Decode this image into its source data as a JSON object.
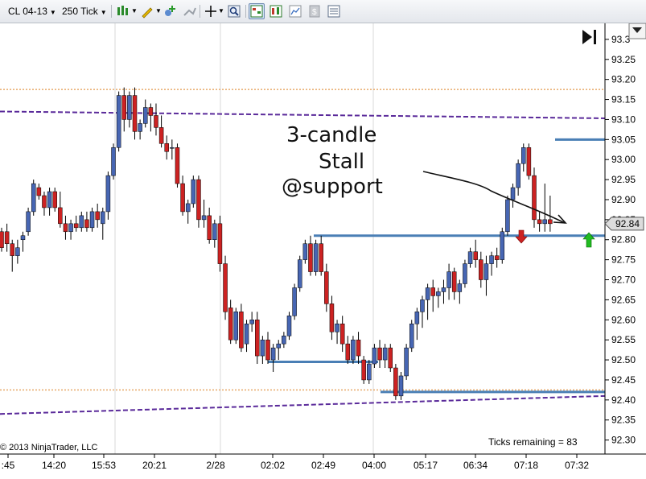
{
  "toolbar": {
    "instrument": "CL 04-13",
    "period": "250 Tick"
  },
  "footer": {
    "copyright": "© 2013 NinjaTrader, LLC",
    "ticks_remaining": "Ticks remaining = 83"
  },
  "annotation": {
    "line1": "3-candle",
    "line2": "Stall",
    "line3": "@support"
  },
  "colors": {
    "up": "#4766b3",
    "down": "#cc2222",
    "hline": "#4a7fb5",
    "channel": "#5a2a9a",
    "dotted": "#e8a96a",
    "arrow_down": "#cc2222",
    "arrow_up": "#22bb22"
  },
  "chart_data": {
    "type": "candlestick",
    "ylim": [
      92.265,
      93.34
    ],
    "y_ticks": [
      "93.3",
      "93.25",
      "93.20",
      "93.15",
      "93.10",
      "93.05",
      "93.00",
      "92.95",
      "92.90",
      "92.85",
      "92.80",
      "92.75",
      "92.70",
      "92.65",
      "92.60",
      "92.55",
      "92.50",
      "92.45",
      "92.40",
      "92.35",
      "92.30"
    ],
    "x_ticks": [
      ":45",
      "14:20",
      "15:53",
      "20:21",
      "2/28",
      "02:02",
      "02:49",
      "04:00",
      "05:17",
      "06:34",
      "07:18",
      "07:32"
    ],
    "last_price": "92.84",
    "candles": [
      [
        92.82,
        92.83,
        92.77,
        92.78
      ],
      [
        92.82,
        92.84,
        92.77,
        92.79
      ],
      [
        92.79,
        92.8,
        92.72,
        92.76
      ],
      [
        92.76,
        92.8,
        92.74,
        92.78
      ],
      [
        92.8,
        92.82,
        92.77,
        92.81
      ],
      [
        92.82,
        92.88,
        92.81,
        92.87
      ],
      [
        92.87,
        92.95,
        92.86,
        92.94
      ],
      [
        92.93,
        92.94,
        92.9,
        92.91
      ],
      [
        92.91,
        92.92,
        92.86,
        92.88
      ],
      [
        92.88,
        92.93,
        92.86,
        92.92
      ],
      [
        92.92,
        92.93,
        92.87,
        92.88
      ],
      [
        92.88,
        92.92,
        92.83,
        92.84
      ],
      [
        92.84,
        92.86,
        92.8,
        92.82
      ],
      [
        92.82,
        92.85,
        92.8,
        92.84
      ],
      [
        92.84,
        92.86,
        92.82,
        92.83
      ],
      [
        92.83,
        92.87,
        92.82,
        92.86
      ],
      [
        92.85,
        92.87,
        92.82,
        92.83
      ],
      [
        92.83,
        92.88,
        92.82,
        92.87
      ],
      [
        92.87,
        92.89,
        92.83,
        92.85
      ],
      [
        92.84,
        92.88,
        92.8,
        92.87
      ],
      [
        92.87,
        92.97,
        92.85,
        92.96
      ],
      [
        92.96,
        93.04,
        92.95,
        93.03
      ],
      [
        93.03,
        93.17,
        93.02,
        93.16
      ],
      [
        93.16,
        93.18,
        93.07,
        93.1
      ],
      [
        93.1,
        93.17,
        93.08,
        93.16
      ],
      [
        93.16,
        93.18,
        93.05,
        93.07
      ],
      [
        93.07,
        93.1,
        93.05,
        93.09
      ],
      [
        93.09,
        93.15,
        93.08,
        93.13
      ],
      [
        93.13,
        93.14,
        93.07,
        93.11
      ],
      [
        93.11,
        93.14,
        93.06,
        93.08
      ],
      [
        93.08,
        93.11,
        93.03,
        93.04
      ],
      [
        93.04,
        93.06,
        93.0,
        93.02
      ],
      [
        93.03,
        93.05,
        93.0,
        93.03
      ],
      [
        93.03,
        93.04,
        92.93,
        92.94
      ],
      [
        92.94,
        92.96,
        92.86,
        92.87
      ],
      [
        92.87,
        92.9,
        92.84,
        92.89
      ],
      [
        92.89,
        92.96,
        92.88,
        92.95
      ],
      [
        92.95,
        92.96,
        92.83,
        92.85
      ],
      [
        92.85,
        92.9,
        92.83,
        92.86
      ],
      [
        92.86,
        92.88,
        92.79,
        92.8
      ],
      [
        92.8,
        92.85,
        92.78,
        92.84
      ],
      [
        92.84,
        92.86,
        92.72,
        92.74
      ],
      [
        92.74,
        92.76,
        92.6,
        92.62
      ],
      [
        92.63,
        92.65,
        92.54,
        92.55
      ],
      [
        92.55,
        92.63,
        92.54,
        92.62
      ],
      [
        92.62,
        92.64,
        92.52,
        92.53
      ],
      [
        92.54,
        92.6,
        92.52,
        92.59
      ],
      [
        92.59,
        92.62,
        92.57,
        92.6
      ],
      [
        92.6,
        92.62,
        92.49,
        92.51
      ],
      [
        92.51,
        92.56,
        92.49,
        92.55
      ],
      [
        92.55,
        92.57,
        92.49,
        92.5
      ],
      [
        92.5,
        92.54,
        92.47,
        92.53
      ],
      [
        92.53,
        92.55,
        92.5,
        92.54
      ],
      [
        92.54,
        92.57,
        92.53,
        92.56
      ],
      [
        92.56,
        92.62,
        92.55,
        92.61
      ],
      [
        92.61,
        92.69,
        92.6,
        92.68
      ],
      [
        92.68,
        92.76,
        92.67,
        92.75
      ],
      [
        92.75,
        92.8,
        92.74,
        92.79
      ],
      [
        92.79,
        92.81,
        92.71,
        92.72
      ],
      [
        92.72,
        92.8,
        92.71,
        92.79
      ],
      [
        92.79,
        92.81,
        92.71,
        92.72
      ],
      [
        92.72,
        92.74,
        92.62,
        92.64
      ],
      [
        92.64,
        92.66,
        92.55,
        92.57
      ],
      [
        92.57,
        92.6,
        92.54,
        92.59
      ],
      [
        92.59,
        92.61,
        92.52,
        92.54
      ],
      [
        92.54,
        92.56,
        92.49,
        92.5
      ],
      [
        92.5,
        92.56,
        92.49,
        92.55
      ],
      [
        92.55,
        92.57,
        92.49,
        92.51
      ],
      [
        92.5,
        92.51,
        92.44,
        92.45
      ],
      [
        92.45,
        92.5,
        92.44,
        92.49
      ],
      [
        92.49,
        92.54,
        92.48,
        92.53
      ],
      [
        92.53,
        92.55,
        92.48,
        92.5
      ],
      [
        92.5,
        92.54,
        92.48,
        92.53
      ],
      [
        92.53,
        92.54,
        92.47,
        92.48
      ],
      [
        92.48,
        92.49,
        92.4,
        92.41
      ],
      [
        92.41,
        92.47,
        92.4,
        92.46
      ],
      [
        92.46,
        92.54,
        92.45,
        92.53
      ],
      [
        92.53,
        92.6,
        92.52,
        92.59
      ],
      [
        92.59,
        92.63,
        92.55,
        92.62
      ],
      [
        92.62,
        92.66,
        92.58,
        92.65
      ],
      [
        92.65,
        92.69,
        92.6,
        92.68
      ],
      [
        92.68,
        92.7,
        92.62,
        92.66
      ],
      [
        92.66,
        92.68,
        92.63,
        92.67
      ],
      [
        92.67,
        92.7,
        92.64,
        92.68
      ],
      [
        92.68,
        92.74,
        92.65,
        92.72
      ],
      [
        92.72,
        92.73,
        92.65,
        92.67
      ],
      [
        92.67,
        92.7,
        92.64,
        92.69
      ],
      [
        92.69,
        92.75,
        92.68,
        92.74
      ],
      [
        92.74,
        92.78,
        92.73,
        92.77
      ],
      [
        92.77,
        92.8,
        92.73,
        92.75
      ],
      [
        92.75,
        92.77,
        92.68,
        92.7
      ],
      [
        92.7,
        92.76,
        92.66,
        92.74
      ],
      [
        92.74,
        92.77,
        92.71,
        92.76
      ],
      [
        92.76,
        92.78,
        92.73,
        92.75
      ],
      [
        92.75,
        92.83,
        92.74,
        92.82
      ],
      [
        92.82,
        92.91,
        92.81,
        92.9
      ],
      [
        92.9,
        92.94,
        92.88,
        92.93
      ],
      [
        92.93,
        93.0,
        92.91,
        92.99
      ],
      [
        92.99,
        93.04,
        92.97,
        93.03
      ],
      [
        93.03,
        93.04,
        92.95,
        92.96
      ],
      [
        92.96,
        92.98,
        92.83,
        92.85
      ],
      [
        92.85,
        92.87,
        92.82,
        92.84
      ],
      [
        92.84,
        92.94,
        92.82,
        92.85
      ],
      [
        92.85,
        92.91,
        92.82,
        92.84
      ]
    ],
    "horizontal_lines": [
      {
        "price": 92.81,
        "x1": 390,
        "x2": 752
      },
      {
        "price": 92.495,
        "x1": 333,
        "x2": 470
      },
      {
        "price": 92.42,
        "x1": 473,
        "x2": 752
      },
      {
        "price": 93.05,
        "x1": 690,
        "x2": 752
      }
    ],
    "dotted_lines": [
      93.175,
      92.425
    ],
    "channel_lines": [
      {
        "p1": [
          0,
          93.12
        ],
        "p2": [
          752,
          93.103
        ]
      },
      {
        "p1": [
          0,
          92.365
        ],
        "p2": [
          752,
          92.41
        ]
      }
    ],
    "time_dividers": [
      143,
      274,
      464
    ]
  }
}
